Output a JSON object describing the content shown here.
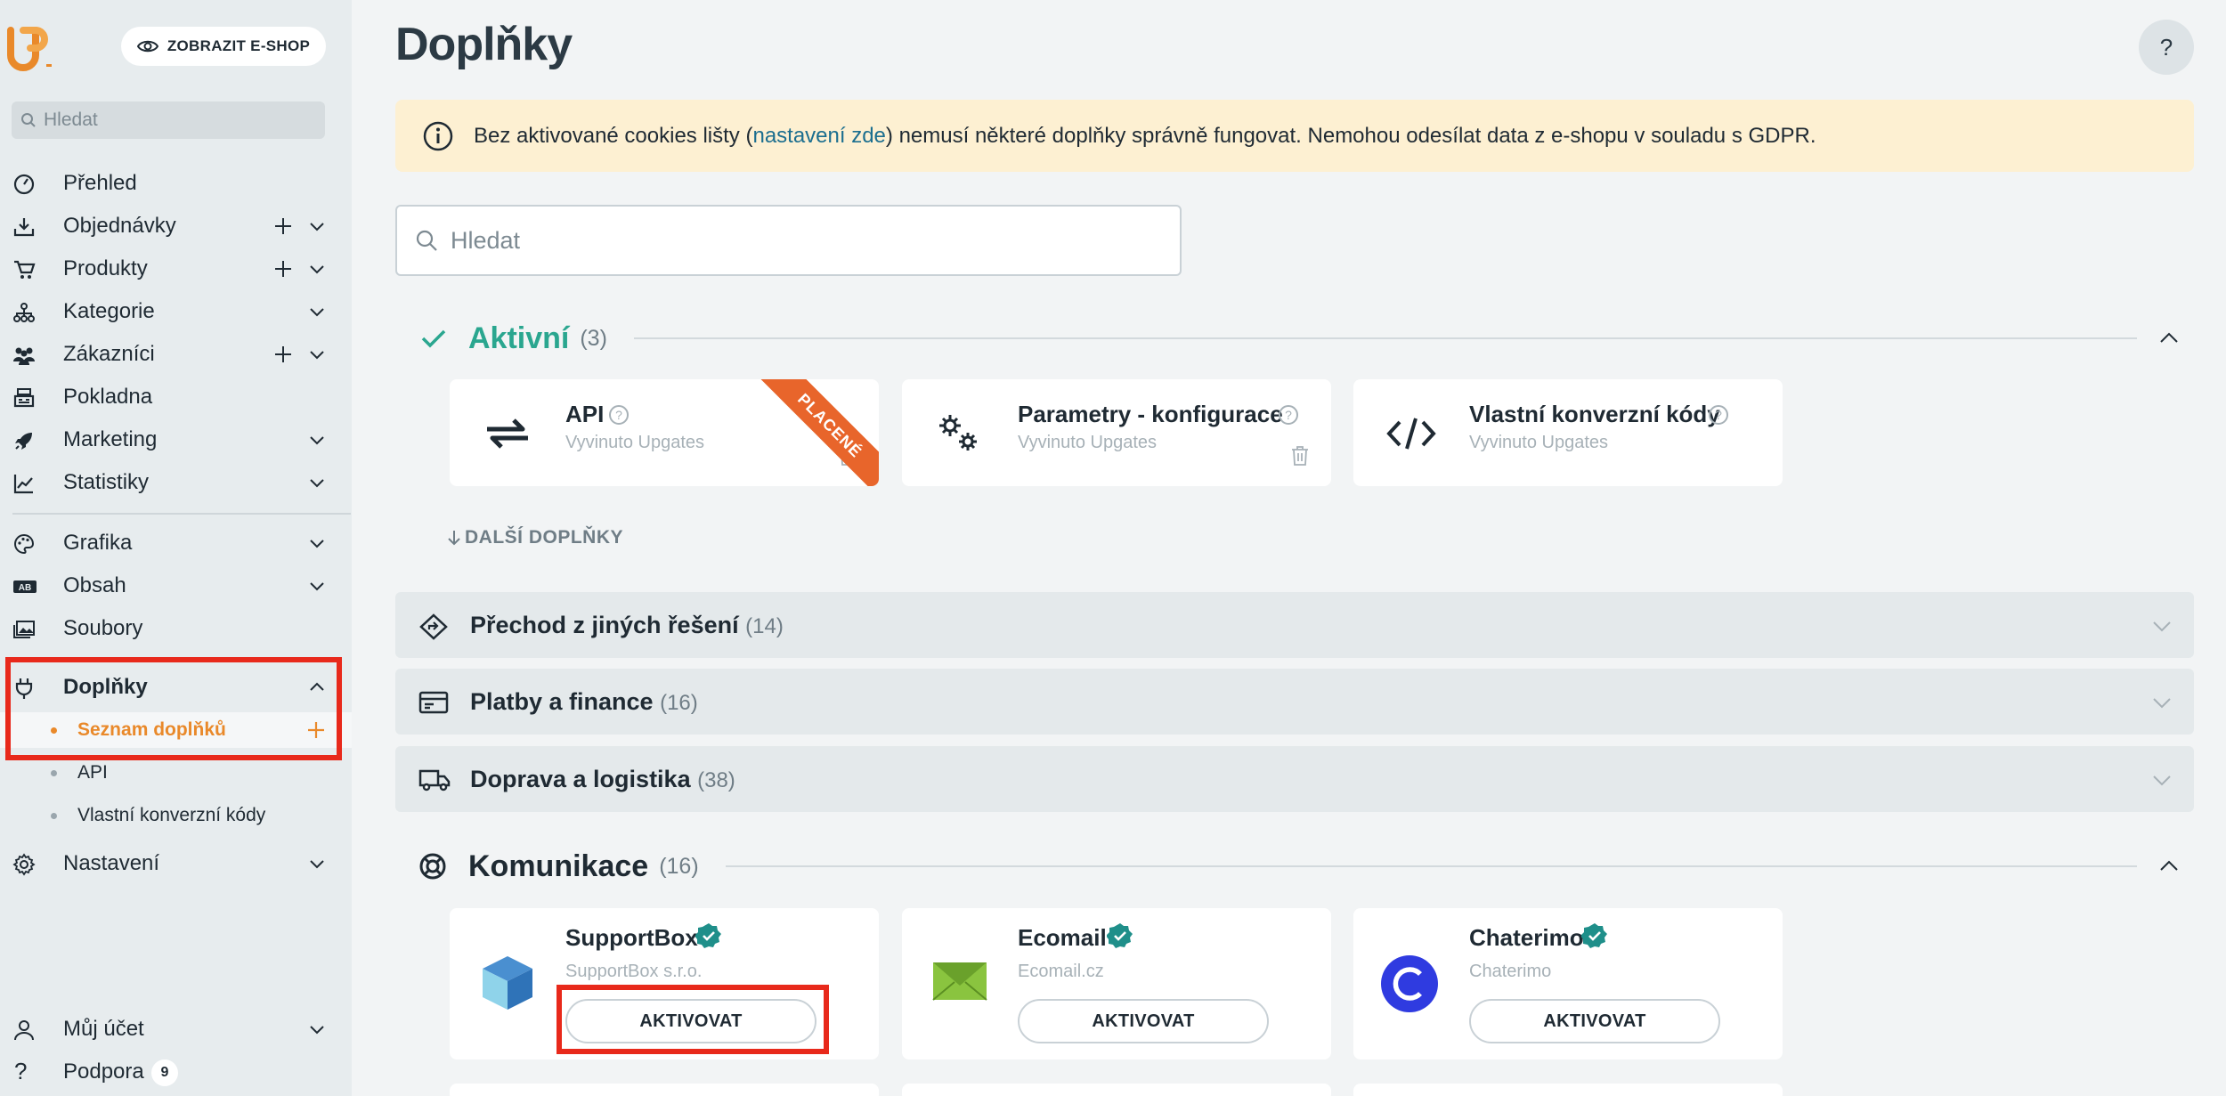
{
  "sidebar": {
    "eshop_button": "ZOBRAZIT E-SHOP",
    "search_placeholder": "Hledat",
    "nav": [
      {
        "label": "Přehled",
        "icon": "dashboard-gauge-icon"
      },
      {
        "label": "Objednávky",
        "icon": "inbox-download-icon"
      },
      {
        "label": "Produkty",
        "icon": "cart-icon"
      },
      {
        "label": "Kategorie",
        "icon": "hierarchy-icon"
      },
      {
        "label": "Zákazníci",
        "icon": "users-icon"
      },
      {
        "label": "Pokladna",
        "icon": "cash-register-icon"
      },
      {
        "label": "Marketing",
        "icon": "rocket-icon"
      },
      {
        "label": "Statistiky",
        "icon": "line-chart-icon"
      },
      {
        "label": "Grafika",
        "icon": "palette-icon"
      },
      {
        "label": "Obsah",
        "icon": "ab-text-icon"
      },
      {
        "label": "Soubory",
        "icon": "images-icon"
      },
      {
        "label": "Doplňky",
        "icon": "plug-icon"
      },
      {
        "label": "Nastavení",
        "icon": "gear-icon"
      }
    ],
    "addons_sub": [
      "Seznam doplňků",
      "API",
      "Vlastní konverzní kódy"
    ],
    "account": "Můj účet",
    "support": "Podpora",
    "support_badge": "9"
  },
  "main": {
    "title": "Doplňky",
    "help": "?",
    "notice": {
      "before": "Bez aktivované cookies lišty (",
      "link": "nastavení zde",
      "after": ") nemusí některé doplňky správně fungovat. Nemohou odesílat data z e-shopu v souladu s GDPR."
    },
    "search_placeholder": "Hledat",
    "active_section": {
      "title": "Aktivní",
      "count": "(3)",
      "cards": [
        {
          "name": "API",
          "dev": "Vyvinuto Upgates",
          "ribbon": "PLACENÉ"
        },
        {
          "name": "Parametry - konfigurace",
          "dev": "Vyvinuto Upgates"
        },
        {
          "name": "Vlastní konverzní kódy",
          "dev": "Vyvinuto Upgates"
        }
      ],
      "more": "DALŠÍ DOPLŇKY"
    },
    "categories": [
      {
        "title": "Přechod z jiných řešení",
        "count": "(14)"
      },
      {
        "title": "Platby a finance",
        "count": "(16)"
      },
      {
        "title": "Doprava a logistika",
        "count": "(38)"
      }
    ],
    "comm_section": {
      "title": "Komunikace",
      "count": "(16)",
      "cards": [
        {
          "name": "SupportBox",
          "dev": "SupportBox s.r.o.",
          "button": "AKTIVOVAT"
        },
        {
          "name": "Ecomail",
          "dev": "Ecomail.cz",
          "button": "AKTIVOVAT"
        },
        {
          "name": "Chaterimo",
          "dev": "Chaterimo",
          "button": "AKTIVOVAT"
        }
      ]
    }
  },
  "colors": {
    "accent_orange": "#e9892a",
    "teal": "#2aa68f",
    "highlight_red": "#e8291b",
    "notice_bg": "#fdf0d2"
  }
}
